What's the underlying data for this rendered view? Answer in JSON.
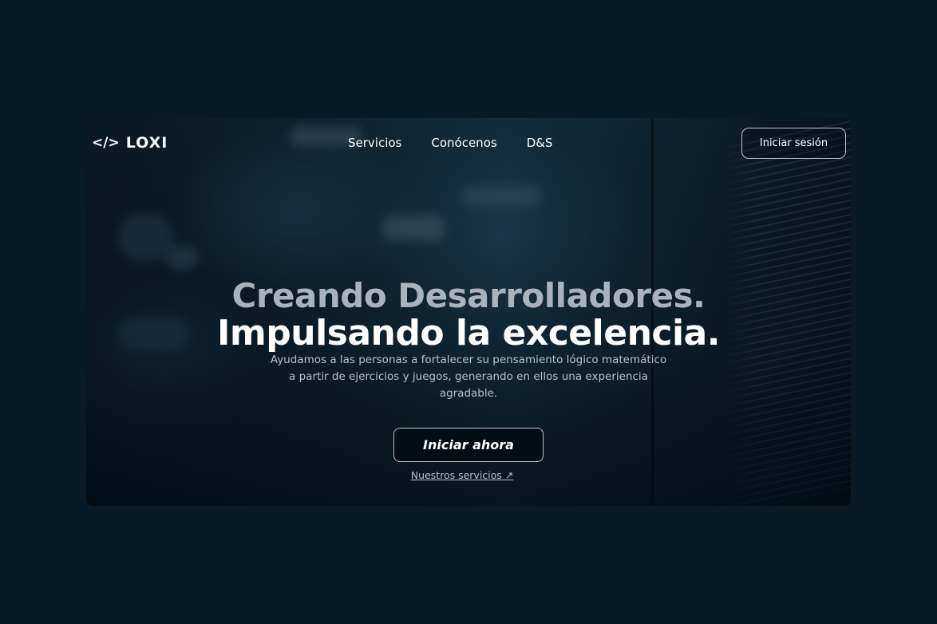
{
  "brand": {
    "logo_icon": "</>",
    "name": "LOXI"
  },
  "nav": {
    "items": [
      {
        "label": "Servicios"
      },
      {
        "label": "Conócenos"
      },
      {
        "label": "D&S"
      }
    ],
    "login_label": "Iniciar sesión"
  },
  "hero": {
    "headline_line1": "Creando Desarrolladores.",
    "headline_line2": "Impulsando la excelencia.",
    "description": "Ayudamos a las personas a fortalecer su pensamiento lógico matemático a partir de ejercicios y juegos, generando en ellos una experiencia agradable.",
    "cta_label": "Iniciar ahora",
    "secondary_link": "Nuestros servicios ↗"
  },
  "colors": {
    "page_background": "#071a28",
    "headline_muted": "#a9b3bd",
    "headline_bright": "#ffffff",
    "body_text": "#b7c0c8"
  }
}
